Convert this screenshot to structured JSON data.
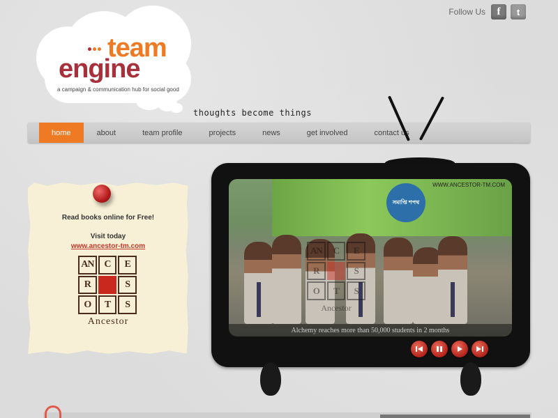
{
  "follow": {
    "label": "Follow Us",
    "facebook_icon": "facebook-icon",
    "twitter_icon": "twitter-icon"
  },
  "logo": {
    "team": "team",
    "engine": "engine",
    "subtitle": "a campaign & communication hub for social good"
  },
  "tagline": "thoughts become things",
  "nav": {
    "items": [
      {
        "label": "home",
        "active": true
      },
      {
        "label": "about"
      },
      {
        "label": "team profile"
      },
      {
        "label": "projects"
      },
      {
        "label": "news"
      },
      {
        "label": "get involved"
      },
      {
        "label": "contact us"
      }
    ]
  },
  "note": {
    "line1": "Read books online for Free!",
    "line2": "Visit today",
    "link": "www.ancestor-tm.com",
    "logo_letters": [
      "ANC",
      "RE",
      "",
      "OTS",
      "",
      "R"
    ],
    "brand": "Ancestor"
  },
  "tv": {
    "site_label": "WWW.ANCESTOR-TM.COM",
    "badge": "সমাপ্তি শপথ",
    "caption": "Alchemy reaches more than 50,000 students in 2 months",
    "watermark_brand": "Ancestor",
    "controls": [
      "rewind-icon",
      "pause-icon",
      "play-icon",
      "forward-icon"
    ]
  },
  "colors": {
    "accent": "#ee7a24",
    "brand_red": "#a8303a",
    "note_bg": "#f7f0d6"
  }
}
